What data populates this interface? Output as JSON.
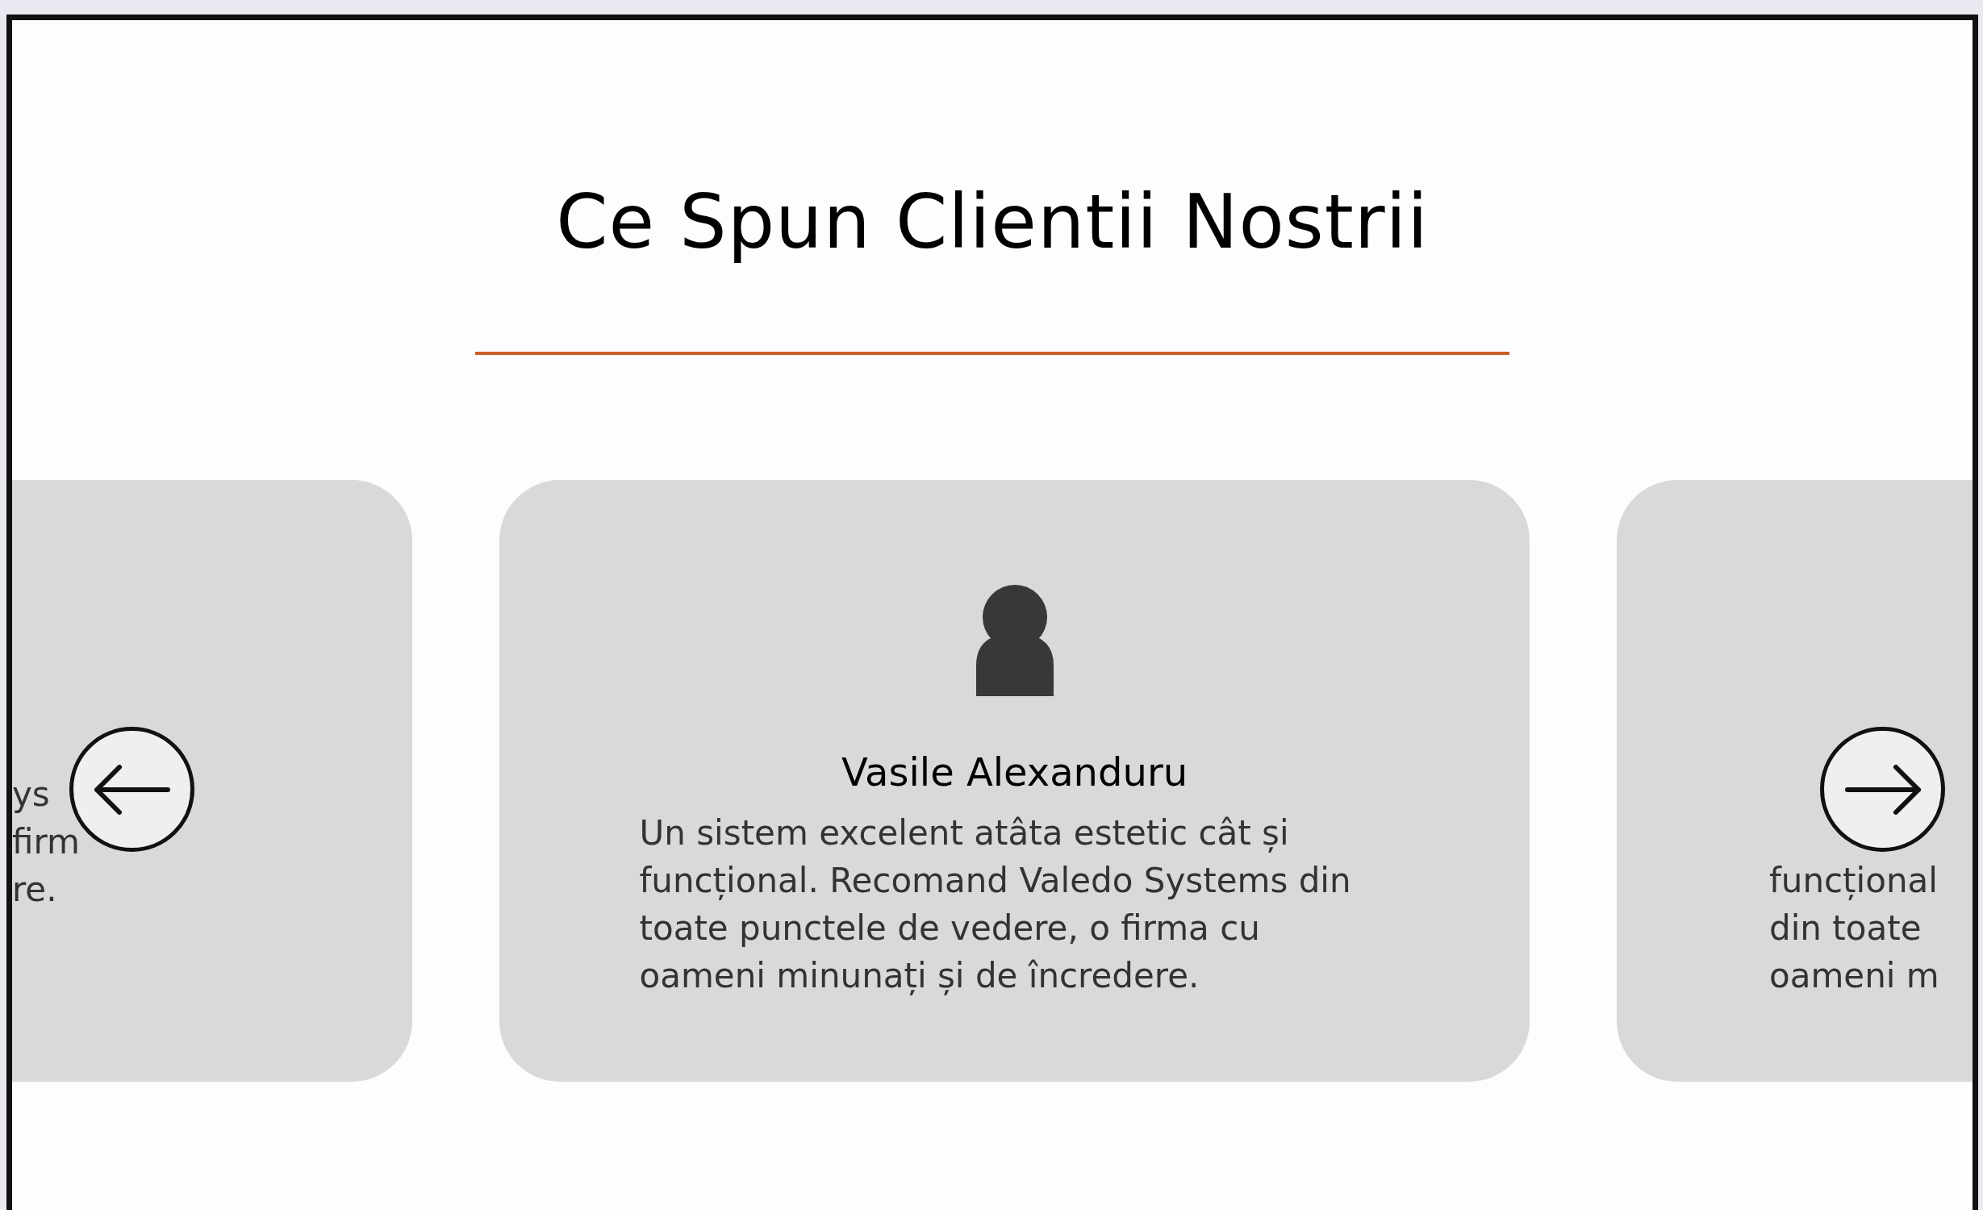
{
  "heading": "Ce Spun Clientii Nostrii",
  "testimonials": [
    {
      "kind": "previous",
      "text_lines": [
        "ys",
        "firm",
        "re."
      ]
    },
    {
      "kind": "current",
      "name": "Vasile Alexanduru",
      "text": "Un sistem excelent atâta estetic cât și funcțional. Recomand Valedo Systems din toate punctele de vedere, o firma cu oameni minunați și de încredere."
    },
    {
      "kind": "next",
      "text_lines": [
        "funcțional",
        "din toate",
        "oameni m"
      ]
    }
  ]
}
